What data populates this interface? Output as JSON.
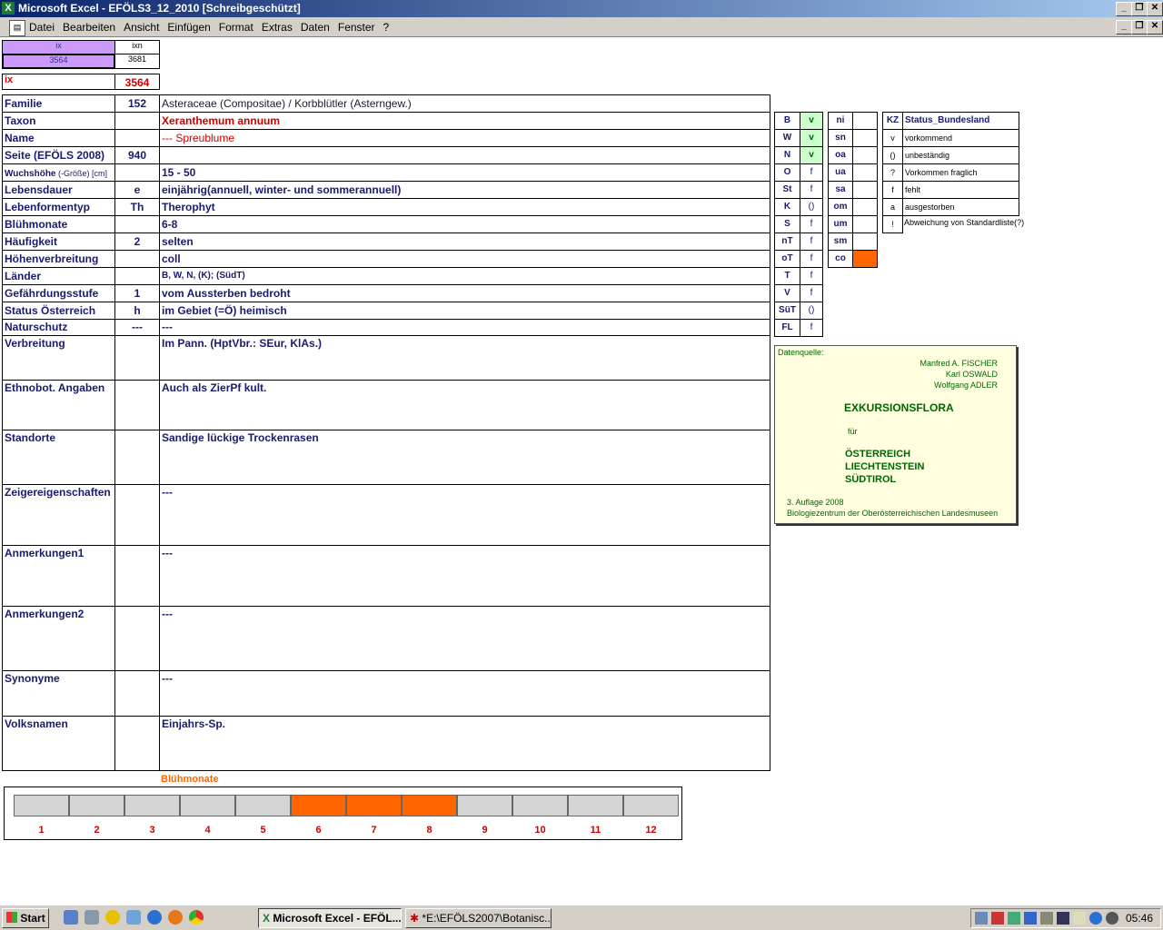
{
  "window": {
    "title": "Microsoft Excel - EFÖLS3_12_2010  [Schreibgeschützt]",
    "menus": [
      "Datei",
      "Bearbeiten",
      "Ansicht",
      "Einfügen",
      "Format",
      "Extras",
      "Daten",
      "Fenster",
      "?"
    ]
  },
  "top_cells": {
    "ix_header": "ix",
    "ixn_header": "ixn",
    "ix_value": "3564",
    "ixn_value": "3681",
    "ix_label": "ix",
    "ix_big": "3564"
  },
  "rows": [
    {
      "label": "Familie",
      "code": "152",
      "value": "Asteraceae (Compositae)  /  Korbblütler (Asterngew.)"
    },
    {
      "label": "Taxon",
      "code": "",
      "value": "Xeranthemum annuum"
    },
    {
      "label": "Name",
      "code": "",
      "value": "--- Spreublume"
    },
    {
      "label": "Seite (EFÖLS 2008)",
      "code": "940",
      "value": ""
    },
    {
      "label": "Wuchshöhe",
      "label_suffix": " (-Größe) [cm]",
      "code": "",
      "value": " 15 - 50"
    },
    {
      "label": "Lebensdauer",
      "code": "e",
      "value": "einjährig(annuell, winter- und sommerannuell)"
    },
    {
      "label": "Lebenformentyp",
      "code": "Th",
      "value": "Therophyt"
    },
    {
      "label": "Blühmonate",
      "code": "",
      "value": " 6-8"
    },
    {
      "label": "Häufigkeit",
      "code": "2",
      "value": "selten"
    },
    {
      "label": "Höhenverbreitung",
      "code": "",
      "value": "coll"
    },
    {
      "label": "Länder",
      "code": "",
      "value": "B, W, N, (K); (SüdT)"
    },
    {
      "label": "Gefährdungsstufe",
      "code": "1",
      "value": "vom Aussterben bedroht"
    },
    {
      "label": "Status Österreich",
      "code": "h",
      "value": "im Gebiet (=Ö) heimisch"
    },
    {
      "label": "Naturschutz",
      "code": "---",
      "value": " ---"
    },
    {
      "label": "Verbreitung",
      "code": "",
      "value": "Im Pann. (HptVbr.: SEur, KlAs.)"
    },
    {
      "label": "Ethnobot. Angaben",
      "code": "",
      "value": " Auch als ZierPf kult."
    },
    {
      "label": "Standorte",
      "code": "",
      "value": "Sandige lückige Trockenrasen"
    },
    {
      "label": "Zeigereigenschaften",
      "code": "",
      "value": "---"
    },
    {
      "label": "Anmerkungen1",
      "code": "",
      "value": "---"
    },
    {
      "label": "Anmerkungen2",
      "code": "",
      "value": "---"
    },
    {
      "label": "Synonyme",
      "code": "",
      "value": "---"
    },
    {
      "label": "Volksnamen",
      "code": "",
      "value": "Einjahrs-Sp."
    }
  ],
  "states": [
    {
      "code": "B",
      "status": "v"
    },
    {
      "code": "W",
      "status": "v"
    },
    {
      "code": "N",
      "status": "v"
    },
    {
      "code": "O",
      "status": "f"
    },
    {
      "code": "St",
      "status": "f"
    },
    {
      "code": "K",
      "status": "()"
    },
    {
      "code": "S",
      "status": "f"
    },
    {
      "code": "nT",
      "status": "f"
    },
    {
      "code": "oT",
      "status": "f"
    },
    {
      "code": "T",
      "status": "f"
    },
    {
      "code": "V",
      "status": "f"
    },
    {
      "code": "SüT",
      "status": "()"
    },
    {
      "code": "FL",
      "status": "f"
    }
  ],
  "altitude": [
    "ni",
    "sn",
    "oa",
    "ua",
    "sa",
    "om",
    "um",
    "sm",
    "co"
  ],
  "legend": {
    "header_kz": "KZ",
    "header_status": "Status_Bundesland",
    "items": [
      {
        "kz": "v",
        "text": "vorkommend"
      },
      {
        "kz": "()",
        "text": "unbeständig"
      },
      {
        "kz": "?",
        "text": "Vorkommen fraglich"
      },
      {
        "kz": "f",
        "text": "fehlt"
      },
      {
        "kz": "a",
        "text": "ausgestorben"
      },
      {
        "kz": "!",
        "text": "Abweichung von Standardliste(?)"
      }
    ]
  },
  "source": {
    "label": "Datenquelle:",
    "authors": [
      "Manfred A. FISCHER",
      "Karl OSWALD",
      "Wolfgang ADLER"
    ],
    "title": "EXKURSIONSFLORA",
    "fuer": "für",
    "regions": [
      "ÖSTERREICH",
      "LIECHTENSTEIN",
      "SÜDTIROL"
    ],
    "edition": "3. Auflage 2008",
    "publisher": "Biologiezentrum der Oberösterreichischen Landesmuseen"
  },
  "bloom": {
    "title": "Blühmonate",
    "months": [
      "1",
      "2",
      "3",
      "4",
      "5",
      "6",
      "7",
      "8",
      "9",
      "10",
      "11",
      "12"
    ],
    "active": [
      false,
      false,
      false,
      false,
      false,
      true,
      true,
      true,
      false,
      false,
      false,
      false
    ]
  },
  "colors": {
    "accent_orange": "#ff6600",
    "present_green": "#ccffcc",
    "ix_purple": "#cc99ff",
    "taxon_red": "#cc0000",
    "label_navy": "#1a1a6e",
    "source_bg": "#ffffe0",
    "source_green": "#006600"
  },
  "taskbar": {
    "start": "Start",
    "tasks": [
      "Microsoft Excel - EFÖL...",
      "*E:\\EFÖLS2007\\Botanisc..."
    ],
    "clock": "05:46"
  }
}
